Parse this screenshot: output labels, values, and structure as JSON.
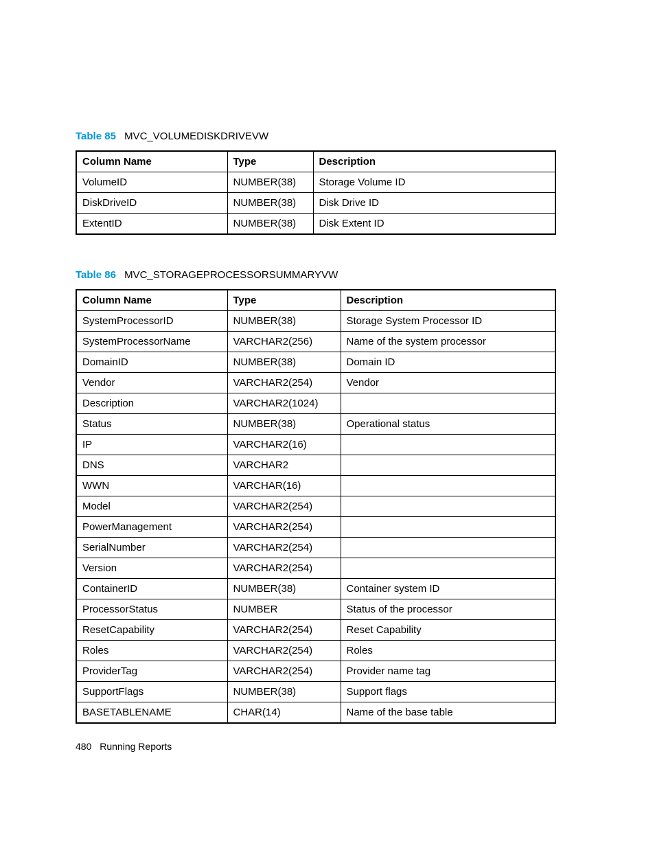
{
  "tables": [
    {
      "label": "Table 85",
      "name": "MVC_VOLUMEDISKDRIVEVW",
      "headers": [
        "Column Name",
        "Type",
        "Description"
      ],
      "rows": [
        {
          "c1": "VolumeID",
          "c2": "NUMBER(38)",
          "c3": "Storage Volume ID"
        },
        {
          "c1": "DiskDriveID",
          "c2": "NUMBER(38)",
          "c3": "Disk Drive ID"
        },
        {
          "c1": "ExtentID",
          "c2": "NUMBER(38)",
          "c3": "Disk Extent ID"
        }
      ]
    },
    {
      "label": "Table 86",
      "name": "MVC_STORAGEPROCESSORSUMMARYVW",
      "headers": [
        "Column Name",
        "Type",
        "Description"
      ],
      "rows": [
        {
          "c1": "SystemProcessorID",
          "c2": "NUMBER(38)",
          "c3": "Storage System Processor ID"
        },
        {
          "c1": "SystemProcessorName",
          "c2": "VARCHAR2(256)",
          "c3": "Name of the system processor"
        },
        {
          "c1": "DomainID",
          "c2": "NUMBER(38)",
          "c3": "Domain ID"
        },
        {
          "c1": "Vendor",
          "c2": "VARCHAR2(254)",
          "c3": "Vendor"
        },
        {
          "c1": "Description",
          "c2": "VARCHAR2(1024)",
          "c3": ""
        },
        {
          "c1": "Status",
          "c2": "NUMBER(38)",
          "c3": "Operational status"
        },
        {
          "c1": "IP",
          "c2": "VARCHAR2(16)",
          "c3": ""
        },
        {
          "c1": "DNS",
          "c2": "VARCHAR2",
          "c3": ""
        },
        {
          "c1": "WWN",
          "c2": "VARCHAR(16)",
          "c3": ""
        },
        {
          "c1": "Model",
          "c2": "VARCHAR2(254)",
          "c3": ""
        },
        {
          "c1": "PowerManagement",
          "c2": "VARCHAR2(254)",
          "c3": ""
        },
        {
          "c1": "SerialNumber",
          "c2": "VARCHAR2(254)",
          "c3": ""
        },
        {
          "c1": "Version",
          "c2": "VARCHAR2(254)",
          "c3": ""
        },
        {
          "c1": "ContainerID",
          "c2": "NUMBER(38)",
          "c3": "Container system ID"
        },
        {
          "c1": "ProcessorStatus",
          "c2": "NUMBER",
          "c3": "Status of the processor"
        },
        {
          "c1": "ResetCapability",
          "c2": "VARCHAR2(254)",
          "c3": "Reset Capability"
        },
        {
          "c1": "Roles",
          "c2": "VARCHAR2(254)",
          "c3": "Roles"
        },
        {
          "c1": "ProviderTag",
          "c2": "VARCHAR2(254)",
          "c3": "Provider name tag"
        },
        {
          "c1": "SupportFlags",
          "c2": "NUMBER(38)",
          "c3": "Support flags"
        },
        {
          "c1": "BASETABLENAME",
          "c2": "CHAR(14)",
          "c3": "Name of the base table"
        }
      ]
    }
  ],
  "footer": {
    "page": "480",
    "section": "Running Reports"
  }
}
